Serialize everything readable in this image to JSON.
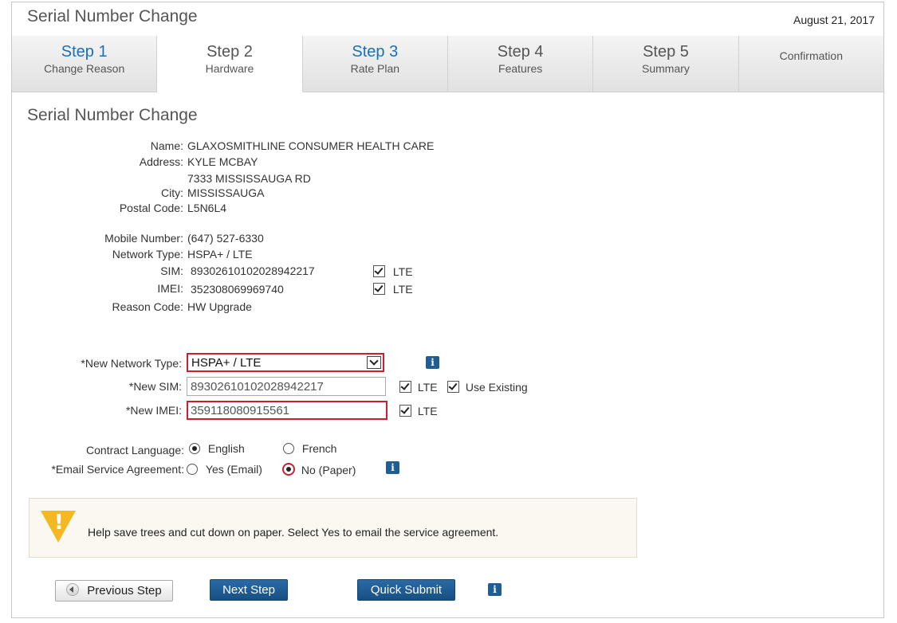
{
  "header": {
    "title": "Serial Number Change",
    "date": "August 21, 2017"
  },
  "steps": [
    {
      "num": "Step 1",
      "label": "Change Reason"
    },
    {
      "num": "Step 2",
      "label": "Hardware"
    },
    {
      "num": "Step 3",
      "label": "Rate Plan"
    },
    {
      "num": "Step 4",
      "label": "Features"
    },
    {
      "num": "Step 5",
      "label": "Summary"
    },
    {
      "num": "",
      "label": "Confirmation"
    }
  ],
  "section": {
    "title": "Serial Number Change"
  },
  "customer": {
    "name_label": "Name:",
    "name": "GLAXOSMITHLINE CONSUMER HEALTH CARE",
    "address_label": "Address:",
    "address1": "KYLE MCBAY",
    "address2": "7333 MISSISSAUGA RD",
    "city_label": "City:",
    "city": "MISSISSAUGA",
    "postal_label": "Postal Code:",
    "postal": "L5N6L4"
  },
  "device": {
    "mobile_label": "Mobile Number:",
    "mobile": "(647) 527-6330",
    "network_label": "Network Type:",
    "network": "HSPA+ / LTE",
    "sim_label": "SIM:",
    "sim": "89302610102028942217",
    "sim_lte": "LTE",
    "imei_label": "IMEI:",
    "imei": "352308069969740",
    "imei_lte": "LTE",
    "reason_label": "Reason Code:",
    "reason": "HW Upgrade"
  },
  "form": {
    "network_label": "*New Network Type:",
    "network_value": "HSPA+ / LTE",
    "sim_label": "*New SIM:",
    "sim_value": "89302610102028942217",
    "sim_lte": "LTE",
    "use_existing": "Use Existing",
    "imei_label": "*New IMEI:",
    "imei_value": "359118080915561",
    "imei_lte": "LTE",
    "language_label": "Contract Language:",
    "english": "English",
    "french": "French",
    "email_label": "*Email Service Agreement:",
    "yes_email": "Yes (Email)",
    "no_paper": "No (Paper)",
    "info_glyph": "i"
  },
  "notice": {
    "text": "Help save trees and cut down on paper. Select Yes to email the service agreement."
  },
  "buttons": {
    "previous": "Previous Step",
    "next": "Next Step",
    "quick_submit": "Quick Submit"
  },
  "colors": {
    "accent_blue": "#1a70b8",
    "button_blue": "#1f5d93",
    "error_red": "#cc1f2f",
    "warning_yellow": "#f3b824"
  }
}
